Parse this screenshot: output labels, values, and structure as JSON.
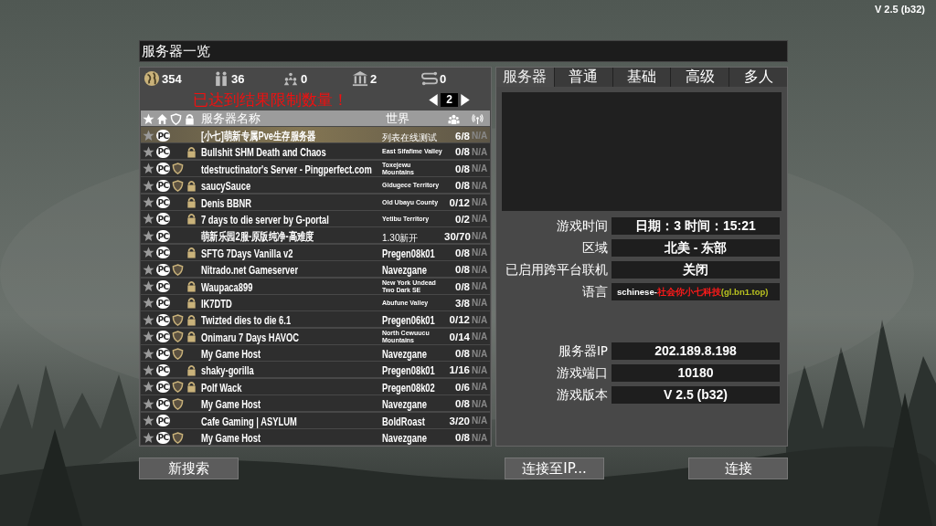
{
  "version": "V 2.5 (b32)",
  "title": "服务器一览",
  "stats": [
    {
      "kind": "globe",
      "count": "354"
    },
    {
      "kind": "players",
      "count": "36"
    },
    {
      "kind": "groups",
      "count": "0"
    },
    {
      "kind": "building",
      "count": "2"
    },
    {
      "kind": "transfer",
      "count": "0"
    }
  ],
  "limit_message": "已达到结果限制数量！",
  "page": "2",
  "columns": {
    "name": "服务器名称",
    "world": "世界"
  },
  "servers": [
    {
      "platform": "PC",
      "verified": false,
      "password": false,
      "name": "[小七]萌新专属Pve生存服务器",
      "world": "列表在线测试",
      "players": "6/8",
      "ping": "N/A",
      "selected": true
    },
    {
      "platform": "PC",
      "verified": false,
      "password": true,
      "name": "Bullshit SHM Death and Chaos",
      "world": "East Sifafime Valley",
      "players": "0/8",
      "ping": "N/A",
      "selected": false
    },
    {
      "platform": "PC",
      "verified": true,
      "password": false,
      "name": "tdestructinator's Server - Pingperfect.com",
      "world": "Toxejewu Mountains",
      "players": "0/8",
      "ping": "N/A",
      "selected": false
    },
    {
      "platform": "PC",
      "verified": true,
      "password": true,
      "name": "saucySauce",
      "world": "Gidugece Territory",
      "players": "0/8",
      "ping": "N/A",
      "selected": false
    },
    {
      "platform": "PC",
      "verified": false,
      "password": true,
      "name": "Denis BBNR",
      "world": "Old Ubayu County",
      "players": "0/12",
      "ping": "N/A",
      "selected": false
    },
    {
      "platform": "PC",
      "verified": false,
      "password": true,
      "name": "7 days to die server by G-portal",
      "world": "Yetibu Territory",
      "players": "0/2",
      "ping": "N/A",
      "selected": false
    },
    {
      "platform": "PC",
      "verified": false,
      "password": false,
      "name": "萌新乐园2服-原版纯净-高难度",
      "world": "1.30新开",
      "players": "30/70",
      "ping": "N/A",
      "selected": false
    },
    {
      "platform": "PC",
      "verified": false,
      "password": true,
      "name": "SFTG 7Days Vanilla v2",
      "world": "Pregen08k01",
      "players": "0/8",
      "ping": "N/A",
      "selected": false
    },
    {
      "platform": "PC",
      "verified": true,
      "password": false,
      "name": "Nitrado.net Gameserver",
      "world": "Navezgane",
      "players": "0/8",
      "ping": "N/A",
      "selected": false
    },
    {
      "platform": "PC",
      "verified": false,
      "password": true,
      "name": "Waupaca899",
      "world": "New York Undead Two Dark SE",
      "players": "0/8",
      "ping": "N/A",
      "selected": false
    },
    {
      "platform": "PC",
      "verified": false,
      "password": true,
      "name": "IK7DTD",
      "world": "Abufune Valley",
      "players": "3/8",
      "ping": "N/A",
      "selected": false
    },
    {
      "platform": "PC",
      "verified": true,
      "password": true,
      "name": "Twizted dies to die 6.1",
      "world": "Pregen06k01",
      "players": "0/12",
      "ping": "N/A",
      "selected": false
    },
    {
      "platform": "PC",
      "verified": true,
      "password": true,
      "name": "Onimaru 7 Days HAVOC",
      "world": "North Cewuucu Mountains",
      "players": "0/14",
      "ping": "N/A",
      "selected": false
    },
    {
      "platform": "PC",
      "verified": true,
      "password": false,
      "name": "My Game Host",
      "world": "Navezgane",
      "players": "0/8",
      "ping": "N/A",
      "selected": false
    },
    {
      "platform": "PC",
      "verified": false,
      "password": true,
      "name": "shaky-gorilla",
      "world": "Pregen08k01",
      "players": "1/16",
      "ping": "N/A",
      "selected": false
    },
    {
      "platform": "PC",
      "verified": true,
      "password": true,
      "name": "Polf Wack",
      "world": "Pregen08k02",
      "players": "0/6",
      "ping": "N/A",
      "selected": false
    },
    {
      "platform": "PC",
      "verified": true,
      "password": false,
      "name": "My Game Host",
      "world": "Navezgane",
      "players": "0/8",
      "ping": "N/A",
      "selected": false
    },
    {
      "platform": "PC",
      "verified": false,
      "password": false,
      "name": "Cafe Gaming | ASYLUM",
      "world": "BoldRoast",
      "players": "3/20",
      "ping": "N/A",
      "selected": false
    },
    {
      "platform": "PC",
      "verified": true,
      "password": false,
      "name": "My Game Host",
      "world": "Navezgane",
      "players": "0/8",
      "ping": "N/A",
      "selected": false
    }
  ],
  "tabs": [
    {
      "label": "服务器",
      "selected": true
    },
    {
      "label": "普通",
      "selected": false
    },
    {
      "label": "基础",
      "selected": false
    },
    {
      "label": "高级",
      "selected": false
    },
    {
      "label": "多人",
      "selected": false
    }
  ],
  "details": [
    {
      "label": "游戏时间",
      "value": "日期：3 时间：15:21"
    },
    {
      "label": "区域",
      "value": "北美 - 东部"
    },
    {
      "label": "已启用跨平台联机",
      "value": "关闭"
    },
    {
      "label": "语言",
      "parts": [
        {
          "text": "schinese-",
          "color": "#ffffff"
        },
        {
          "text": "社会你小七科技",
          "color": "#ff1a1a"
        },
        {
          "text": "(gl.bn1.top)",
          "color": "#b8c020"
        }
      ]
    }
  ],
  "connection": [
    {
      "label": "服务器IP",
      "value": "202.189.8.198"
    },
    {
      "label": "游戏端口",
      "value": "10180"
    },
    {
      "label": "游戏版本",
      "value": "V 2.5 (b32)"
    }
  ],
  "buttons": [
    {
      "label": "新搜索"
    },
    {
      "label": "连接至IP..."
    },
    {
      "label": "连接"
    }
  ]
}
